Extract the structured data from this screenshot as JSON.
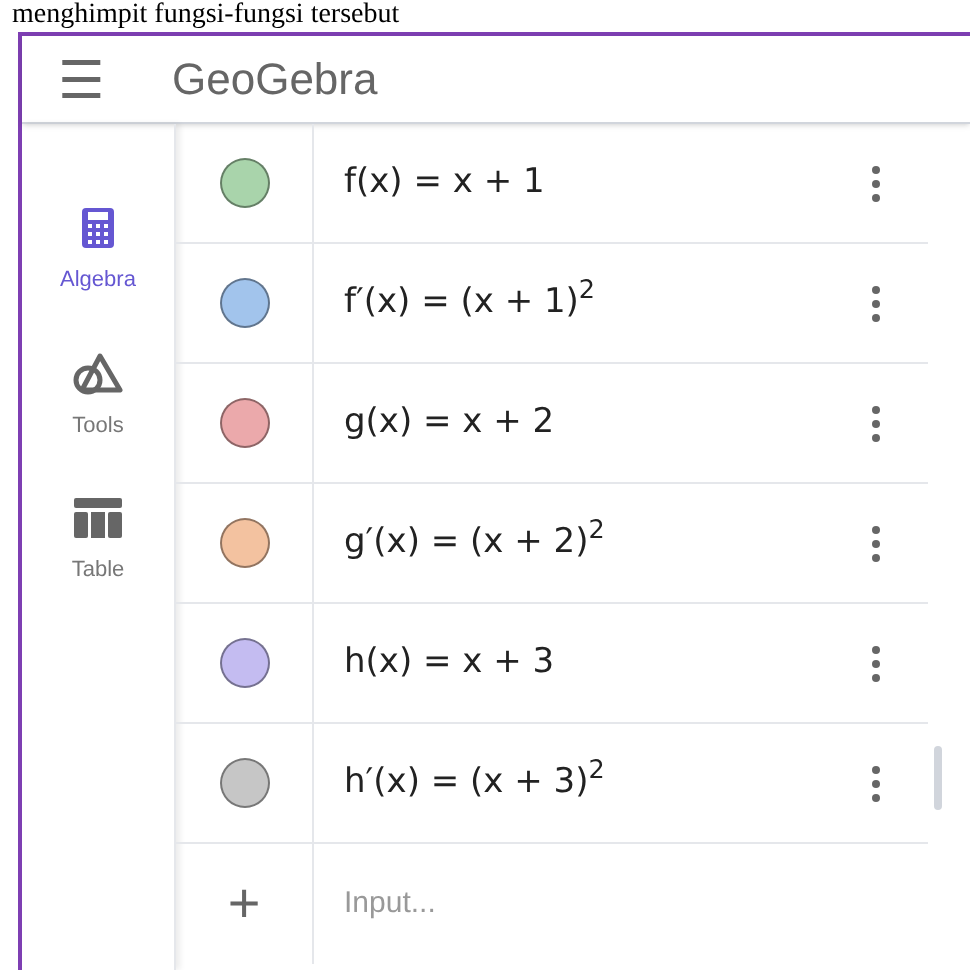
{
  "caption": "menghimpit fungsi-fungsi tersebut",
  "header": {
    "menu_glyph": "☰",
    "logo": "GeoGebra"
  },
  "sidebar": {
    "items": [
      {
        "label": "Algebra",
        "kind": "calculator",
        "selected": true
      },
      {
        "label": "Tools",
        "kind": "tools",
        "selected": false
      },
      {
        "label": "Table",
        "kind": "table",
        "selected": false
      }
    ]
  },
  "algebra": {
    "rows": [
      {
        "expression": "f(x) = x + 1",
        "color": "#a9d4ab"
      },
      {
        "expression": "f′(x) = (x + 1)$^{2}$",
        "color": "#a2c4ec"
      },
      {
        "expression": "g(x) = x + 2",
        "color": "#eba9ab"
      },
      {
        "expression": "g′(x) = (x + 2)$^{2}$",
        "color": "#f3c2a0"
      },
      {
        "expression": "h(x) = x + 3",
        "color": "#c4bcf1"
      },
      {
        "expression": "h′(x) = (x + 3)$^{2}$",
        "color": "#c6c6c6"
      }
    ],
    "input": {
      "add_glyph": "+",
      "placeholder": "Input..."
    }
  }
}
